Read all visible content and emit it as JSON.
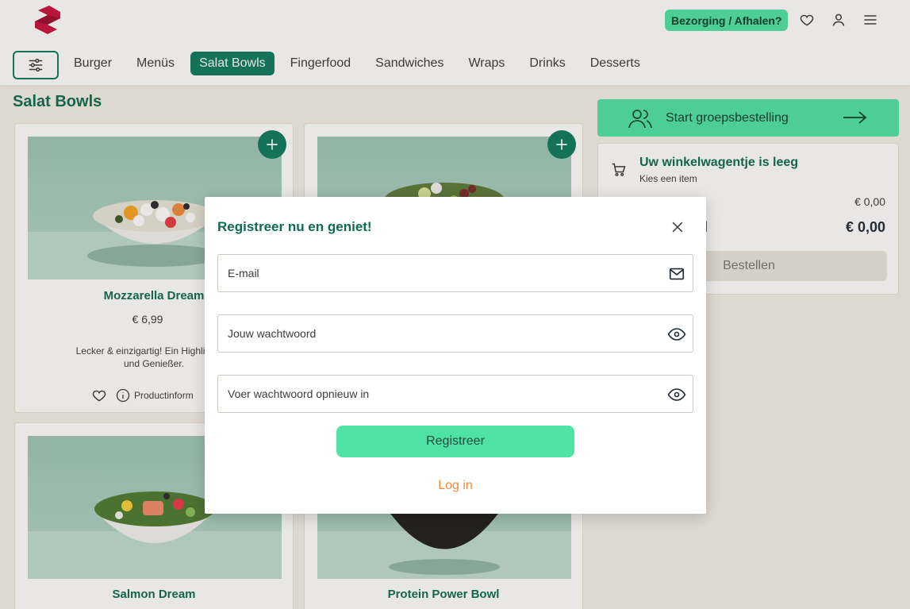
{
  "header": {
    "delivery_label": "Bezorging / Afhalen?",
    "icons": [
      "heart-icon",
      "user-icon",
      "menu-icon"
    ]
  },
  "categories": {
    "items": [
      "Burger",
      "Menüs",
      "Salat Bowls",
      "Fingerfood",
      "Sandwiches",
      "Wraps",
      "Drinks",
      "Desserts"
    ],
    "active": "Salat Bowls"
  },
  "page": {
    "title": "Salat Bowls"
  },
  "products": [
    {
      "name": "Mozzarella Dream",
      "price": "€ 6,99",
      "desc_line1": "Lecker & einzigartig! Ein Highlight für",
      "desc_line2": "und Genießer.",
      "info_label": "Productinform"
    },
    {
      "name": "",
      "price": ""
    },
    {
      "name": "Salmon Dream"
    },
    {
      "name": "Protein Power Bowl"
    }
  ],
  "group_order": {
    "label": "Start groepsbestelling"
  },
  "cart": {
    "title": "Uw winkelwagentje is leeg",
    "subtitle": "Kies een item",
    "subtotal_value": "€ 0,00",
    "total_label": "otaal",
    "total_value": "€ 0,00",
    "order_label": "Bestellen"
  },
  "modal": {
    "title": "Registreer nu en geniet!",
    "email_placeholder": "E-mail",
    "password_placeholder": "Jouw wachtwoord",
    "repeat_placeholder": "Voer wachtwoord opnieuw in",
    "register_label": "Registreer",
    "login_label": "Log in"
  },
  "colors": {
    "brand_green": "#0d7a5f",
    "mint": "#4ee3a4",
    "logo": "#c8103e",
    "login_orange": "#f08a3c"
  }
}
